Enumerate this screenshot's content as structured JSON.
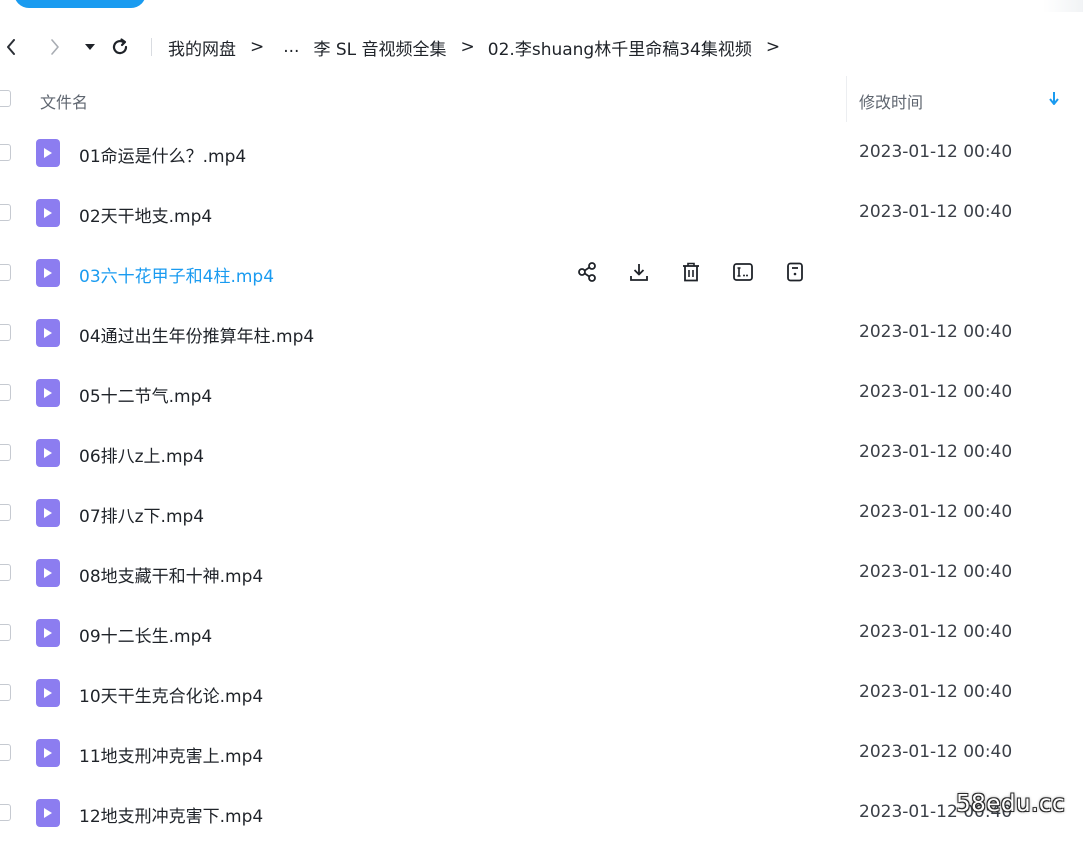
{
  "nav": {
    "crumbs": [
      "我的网盘",
      "...",
      "李 SL 音视频全集",
      "02.李shuang林千里命稿34集视频"
    ]
  },
  "header": {
    "name_col": "文件名",
    "time_col": "修改时间"
  },
  "files": [
    {
      "name": "01命运是什么？.mp4",
      "time": "2023-01-12 00:40"
    },
    {
      "name": "02天干地支.mp4",
      "time": "2023-01-12 00:40"
    },
    {
      "name": "03六十花甲子和4柱.mp4",
      "time": ""
    },
    {
      "name": "04通过出生年份推算年柱.mp4",
      "time": "2023-01-12 00:40"
    },
    {
      "name": "05十二节气.mp4",
      "time": "2023-01-12 00:40"
    },
    {
      "name": "06排八z上.mp4",
      "time": "2023-01-12 00:40"
    },
    {
      "name": "07排八z下.mp4",
      "time": "2023-01-12 00:40"
    },
    {
      "name": "08地支藏干和十神.mp4",
      "time": "2023-01-12 00:40"
    },
    {
      "name": "09十二长生.mp4",
      "time": "2023-01-12 00:40"
    },
    {
      "name": "10天干生克合化论.mp4",
      "time": "2023-01-12 00:40"
    },
    {
      "name": "11地支刑冲克害上.mp4",
      "time": "2023-01-12 00:40"
    },
    {
      "name": "12地支刑冲克害下.mp4",
      "time": "2023-01-12 00:40"
    }
  ],
  "hover_actions": [
    "share-icon",
    "download-icon",
    "delete-icon",
    "rename-icon",
    "more-icon"
  ],
  "watermark": "58edu.cc",
  "colors": {
    "accent": "#1a9bf0",
    "video_icon": "#8c7df0"
  }
}
